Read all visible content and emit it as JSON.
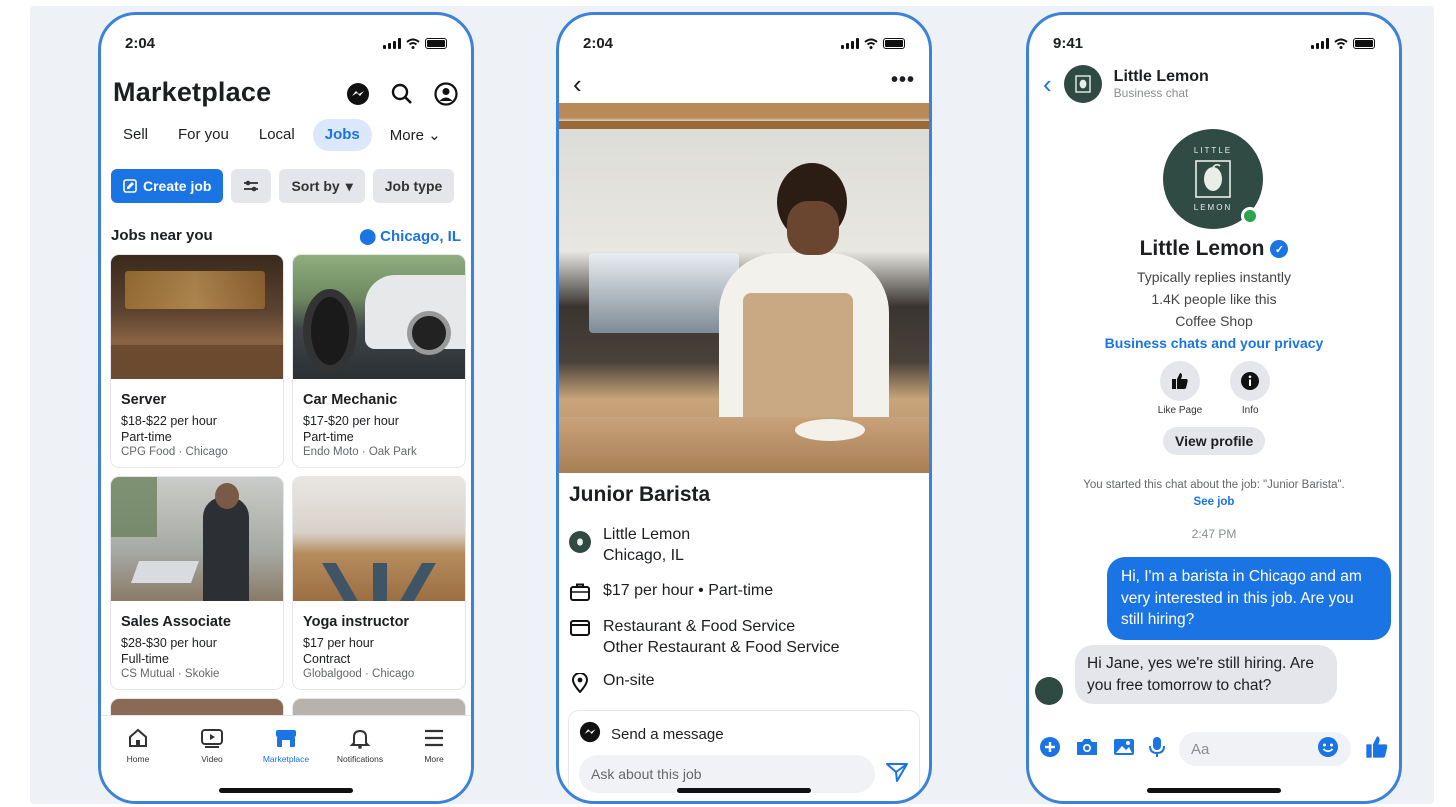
{
  "accent": "#1b74e4",
  "phone1": {
    "time": "2:04",
    "title": "Marketplace",
    "tabs": [
      "Sell",
      "For you",
      "Local",
      "Jobs",
      "More"
    ],
    "filters": {
      "create": "Create job",
      "sort": "Sort by",
      "type": "Job type"
    },
    "section": "Jobs near you",
    "location": "Chicago, IL",
    "jobs": [
      {
        "title": "Server",
        "pay": "$18-$22 per hour",
        "type": "Part-time",
        "company": "CPG Food · Chicago"
      },
      {
        "title": "Car Mechanic",
        "pay": "$17-$20 per hour",
        "type": "Part-time",
        "company": "Endo Moto · Oak Park"
      },
      {
        "title": "Sales Associate",
        "pay": "$28-$30 per hour",
        "type": "Full-time",
        "company": "CS Mutual · Skokie"
      },
      {
        "title": "Yoga instructor",
        "pay": "$17 per hour",
        "type": "Contract",
        "company": "Globalgood · Chicago"
      }
    ],
    "nav": [
      "Home",
      "Video",
      "Marketplace",
      "Notifications",
      "More"
    ]
  },
  "phone2": {
    "time": "2:04",
    "job_title": "Junior Barista",
    "company": "Little Lemon",
    "city": "Chicago, IL",
    "pay": "$17 per hour • Part-time",
    "category1": "Restaurant & Food Service",
    "category2": "Other Restaurant & Food Service",
    "site": "On-site",
    "send": "Send a message",
    "placeholder": "Ask about this job"
  },
  "phone3": {
    "time": "9:41",
    "name": "Little Lemon",
    "subtitle": "Business chat",
    "logo_top": "LITTLE",
    "logo_bottom": "LEMON",
    "replies": "Typically replies instantly",
    "likes": "1.4K people like this",
    "category": "Coffee Shop",
    "privacy": "Business chats and your privacy",
    "like_page": "Like Page",
    "info": "Info",
    "view_profile": "View profile",
    "started": "You started this chat about the job: \"Junior Barista\".",
    "see_job": "See job",
    "timestamp": "2:47 PM",
    "msg_out": "Hi, I'm a barista in Chicago and am very interested in this job. Are you still hiring?",
    "msg_in": "Hi Jane, yes we're still hiring. Are you free tomorrow to chat?",
    "composer_placeholder": "Aa"
  }
}
